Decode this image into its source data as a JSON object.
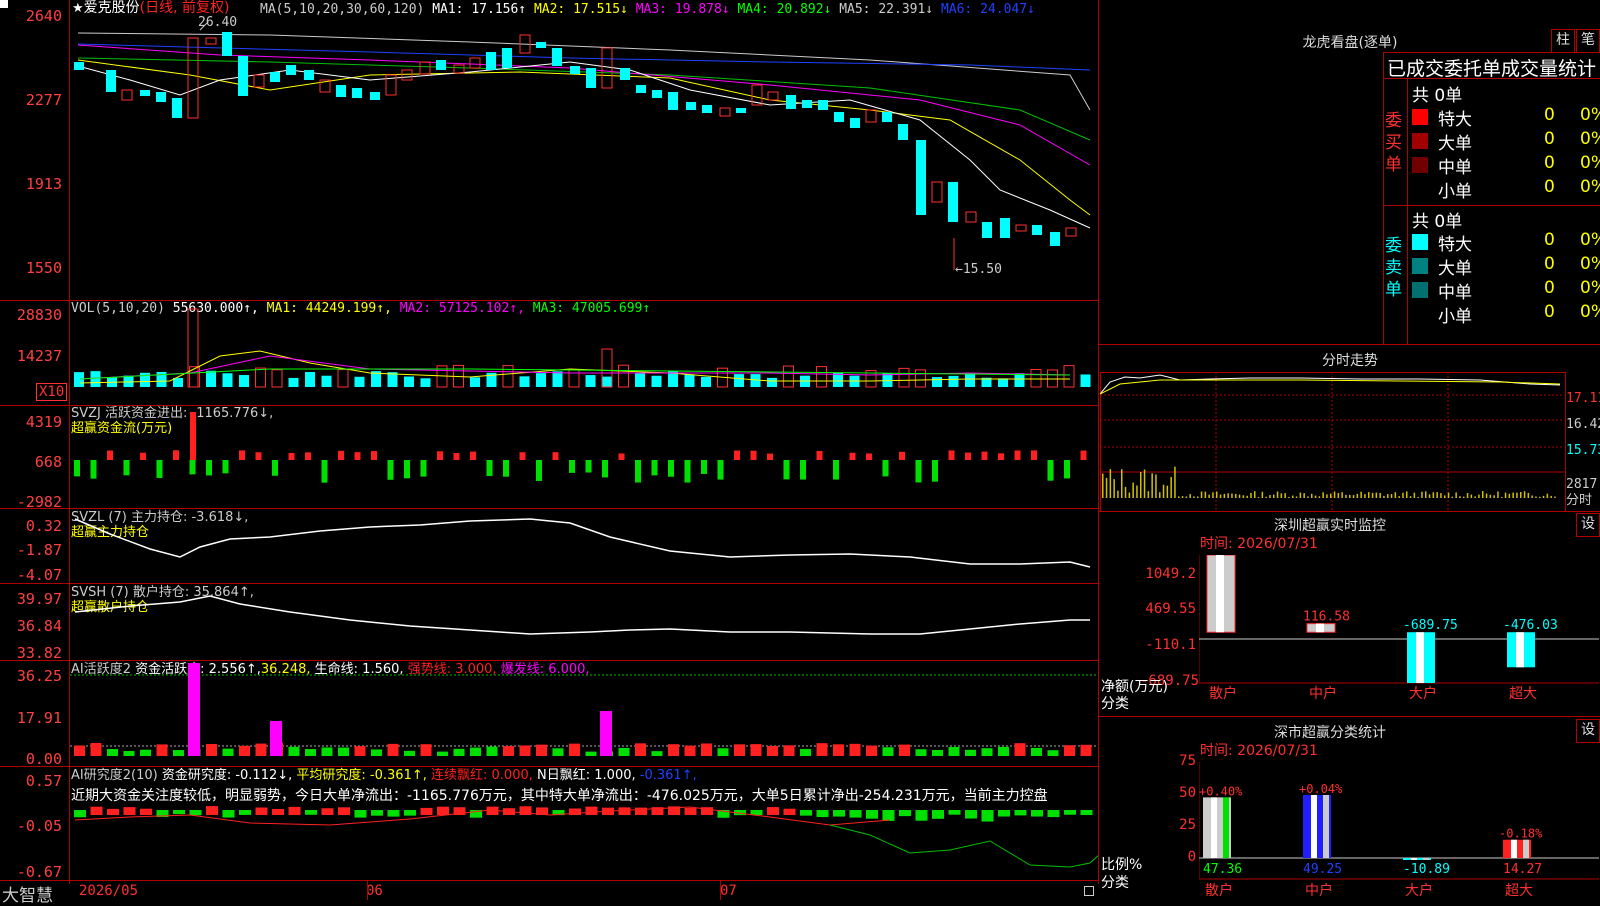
{
  "app": {
    "name": "大智慧"
  },
  "stock": {
    "star": "★",
    "name": "爱克股份",
    "period": "(日线, 前复权)"
  },
  "ma_header": {
    "params": "MA(5,10,20,30,60,120)",
    "ma1": "MA1: 17.156↑",
    "ma2": "MA2: 17.515↓",
    "ma3": "MA3: 19.878↓",
    "ma4": "MA4: 20.892↓",
    "ma5": "MA5: 22.391↓",
    "ma6": "MA6: 24.047↓"
  },
  "price_axis": [
    "2640",
    "2277",
    "1913",
    "1550"
  ],
  "price_marks": {
    "high": "26.40",
    "low": "←15.50"
  },
  "vol_header": {
    "params": "VOL(5,10,20)",
    "vol": "55630.000↑,",
    "ma1": "MA1: 44249.199↑,",
    "ma2": "MA2: 57125.102↑,",
    "ma3": "MA3: 47005.699↑"
  },
  "vol_axis": [
    "28830",
    "14237",
    "X10"
  ],
  "svzj": {
    "header": "SVZJ  活跃资金进出: -1165.776↓,",
    "sub": "超赢资金流(万元)",
    "axis": [
      "4319",
      "668",
      "-2982"
    ]
  },
  "svzl": {
    "header": "SVZL (7) 主力持仓: -3.618↓,",
    "sub": "超赢主力持仓",
    "axis": [
      "0.32",
      "-1.87",
      "-4.07"
    ]
  },
  "svsh": {
    "header": "SVSH (7) 散户持仓: 35.864↑,",
    "sub": "超赢散户持仓",
    "axis": [
      "39.97",
      "36.84",
      "33.82"
    ]
  },
  "ai_active": {
    "name": "AI活跃度2",
    "l1": "资金活跃度: 2.556↑,",
    "l2": "36.248,",
    "l3": "生命线: 1.560,",
    "l4": "强势线: 3.000,",
    "l5": "爆发线: 6.000,",
    "axis": [
      "36.25",
      "17.91",
      "0.00"
    ]
  },
  "ai_research": {
    "name": "AI研究度2(10)",
    "l1": "资金研究度: -0.112↓,",
    "l2": "平均研究度: -0.361↑,",
    "l3": "连续飘红: 0.000,",
    "l4": "N日飘红: 1.000,",
    "l5": "-0.361↑,",
    "desc": "近期大资金关注度较低，明显弱势，今日大单净流出：-1165.776万元，其中特大单净流出：-476.025万元，大单5日累计净出-254.231万元，当前主力控盘",
    "axis": [
      "0.57",
      "-0.05",
      "-0.67"
    ]
  },
  "date_axis": [
    "2026/05",
    "06",
    "07"
  ],
  "dragon": {
    "title": "龙虎看盘(逐单)",
    "btn1": "柱",
    "btn2": "笔",
    "heading": "已成交委托单成交量统计",
    "buy": {
      "side": "委买单",
      "total": "共 0单",
      "rows": [
        {
          "label": "特大",
          "n": "0",
          "p": "0%",
          "color": "#ff0000"
        },
        {
          "label": "大单",
          "n": "0",
          "p": "0%",
          "color": "#a00000"
        },
        {
          "label": "中单",
          "n": "0",
          "p": "0%",
          "color": "#700000"
        },
        {
          "label": "小单",
          "n": "0",
          "p": "0%",
          "color": ""
        }
      ]
    },
    "sell": {
      "side": "委卖单",
      "total": "共 0单",
      "rows": [
        {
          "label": "特大",
          "n": "0",
          "p": "0%",
          "color": "#00ffff"
        },
        {
          "label": "大单",
          "n": "0",
          "p": "0%",
          "color": "#008080"
        },
        {
          "label": "中单",
          "n": "0",
          "p": "0%",
          "color": "#007070"
        },
        {
          "label": "小单",
          "n": "0",
          "p": "0%",
          "color": ""
        }
      ]
    }
  },
  "intraday": {
    "title": "分时走势",
    "axis": [
      "17.11",
      "16.42",
      "15.73",
      "2817",
      "分时"
    ]
  },
  "monitor": {
    "title": "深圳超赢实时监控",
    "btn": "设",
    "time": "时间: 2026/07/31",
    "axis": [
      "1049.2",
      "469.55",
      "-110.1",
      "-689.75"
    ],
    "ylabel": "净额(万元)",
    "xlabel": "分类",
    "cats": [
      "散户",
      "中户",
      "大户",
      "超大"
    ],
    "values": [
      1049.2,
      116.58,
      -689.75,
      -476.03
    ],
    "value_labels": [
      "1049.2",
      "116.58",
      "-689.75",
      "-476.03"
    ]
  },
  "classify": {
    "title": "深市超赢分类统计",
    "btn": "设",
    "time": "时间: 2026/07/31",
    "axis": [
      "75",
      "50",
      "25",
      "0"
    ],
    "ylabel": "比例%",
    "xlabel": "分类",
    "cats": [
      "散户",
      "中户",
      "大户",
      "超大"
    ],
    "values": [
      47.36,
      49.25,
      -10.89,
      14.27
    ],
    "top_labels": [
      "+0.40%",
      "+0.04%",
      "",
      "-0.18%"
    ],
    "bottom_labels": [
      "47.36",
      "49.25",
      "-10.89",
      "14.27"
    ]
  },
  "chart_data": {
    "type": "bar",
    "title": "深圳超赢实时监控",
    "categories": [
      "散户",
      "中户",
      "大户",
      "超大"
    ],
    "values": [
      1049.2,
      116.58,
      -689.75,
      -476.03
    ],
    "ylabel": "净额(万元)",
    "xlabel": "分类"
  }
}
